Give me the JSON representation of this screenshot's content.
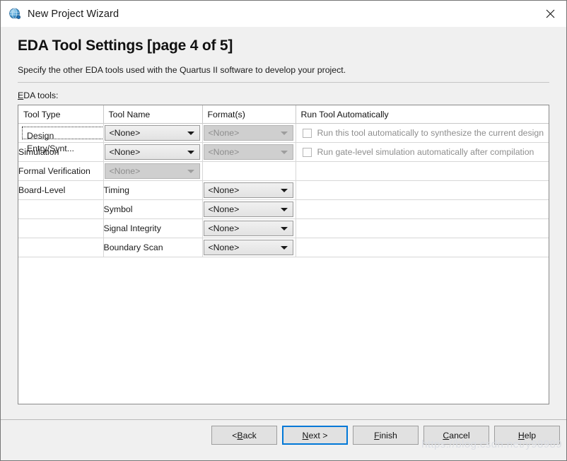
{
  "window": {
    "title": "New Project Wizard",
    "app_icon": "globe-icon",
    "close_label": "✕"
  },
  "page": {
    "title": "EDA Tool Settings [page 4 of 5]",
    "description": "Specify the other EDA tools used with the Quartus II software to develop your project.",
    "section_label_mnemonic": "E",
    "section_label_rest": "DA tools:"
  },
  "table": {
    "headers": [
      "Tool Type",
      "Tool Name",
      "Format(s)",
      "Run Tool Automatically"
    ],
    "rows": [
      {
        "tool_type": "Design Entry/Synt...",
        "tool_type_focused": true,
        "tool_name": "<None>",
        "tool_name_disabled": false,
        "format": "<None>",
        "format_disabled": true,
        "has_checkbox": true,
        "checkbox_checked": false,
        "run_text": "Run this tool automatically to synthesize the current design"
      },
      {
        "tool_type": "Simulation",
        "tool_type_focused": false,
        "tool_name": "<None>",
        "tool_name_disabled": false,
        "format": "<None>",
        "format_disabled": true,
        "has_checkbox": true,
        "checkbox_checked": false,
        "run_text": "Run gate-level simulation automatically after compilation"
      },
      {
        "tool_type": "Formal Verification",
        "tool_type_focused": false,
        "tool_name": "<None>",
        "tool_name_disabled": true,
        "format": "",
        "format_disabled": false,
        "has_checkbox": false,
        "run_text": ""
      },
      {
        "tool_type": "Board-Level",
        "tool_type_focused": false,
        "tool_name": "Timing",
        "tool_name_is_text": true,
        "format": "<None>",
        "format_disabled": false,
        "has_checkbox": false,
        "run_text": ""
      },
      {
        "tool_type": "",
        "tool_type_focused": false,
        "tool_name": "Symbol",
        "tool_name_is_text": true,
        "format": "<None>",
        "format_disabled": false,
        "has_checkbox": false,
        "run_text": ""
      },
      {
        "tool_type": "",
        "tool_type_focused": false,
        "tool_name": "Signal Integrity",
        "tool_name_is_text": true,
        "format": "<None>",
        "format_disabled": false,
        "has_checkbox": false,
        "run_text": ""
      },
      {
        "tool_type": "",
        "tool_type_focused": false,
        "tool_name": "Boundary Scan",
        "tool_name_is_text": true,
        "format": "<None>",
        "format_disabled": false,
        "has_checkbox": false,
        "run_text": ""
      }
    ]
  },
  "footer": {
    "buttons": [
      {
        "name": "back",
        "mnemonic_pre": "< ",
        "mnemonic": "B",
        "post": "ack",
        "focused": false
      },
      {
        "name": "next",
        "mnemonic_pre": "",
        "mnemonic": "N",
        "post": "ext >",
        "focused": true
      },
      {
        "name": "finish",
        "mnemonic_pre": "",
        "mnemonic": "F",
        "post": "inish",
        "focused": false
      },
      {
        "name": "cancel",
        "mnemonic_pre": "",
        "mnemonic": "C",
        "post": "ancel",
        "focused": false
      },
      {
        "name": "help",
        "mnemonic_pre": "",
        "mnemonic": "H",
        "post": "elp",
        "focused": false
      }
    ],
    "watermark": "https://blog.csdn.net/y98989"
  },
  "colors": {
    "accent": "#0078d7",
    "body_bg": "#f0f0f0",
    "titlebar_bg": "#ffffff",
    "disabled_text": "#8e8e8e"
  }
}
